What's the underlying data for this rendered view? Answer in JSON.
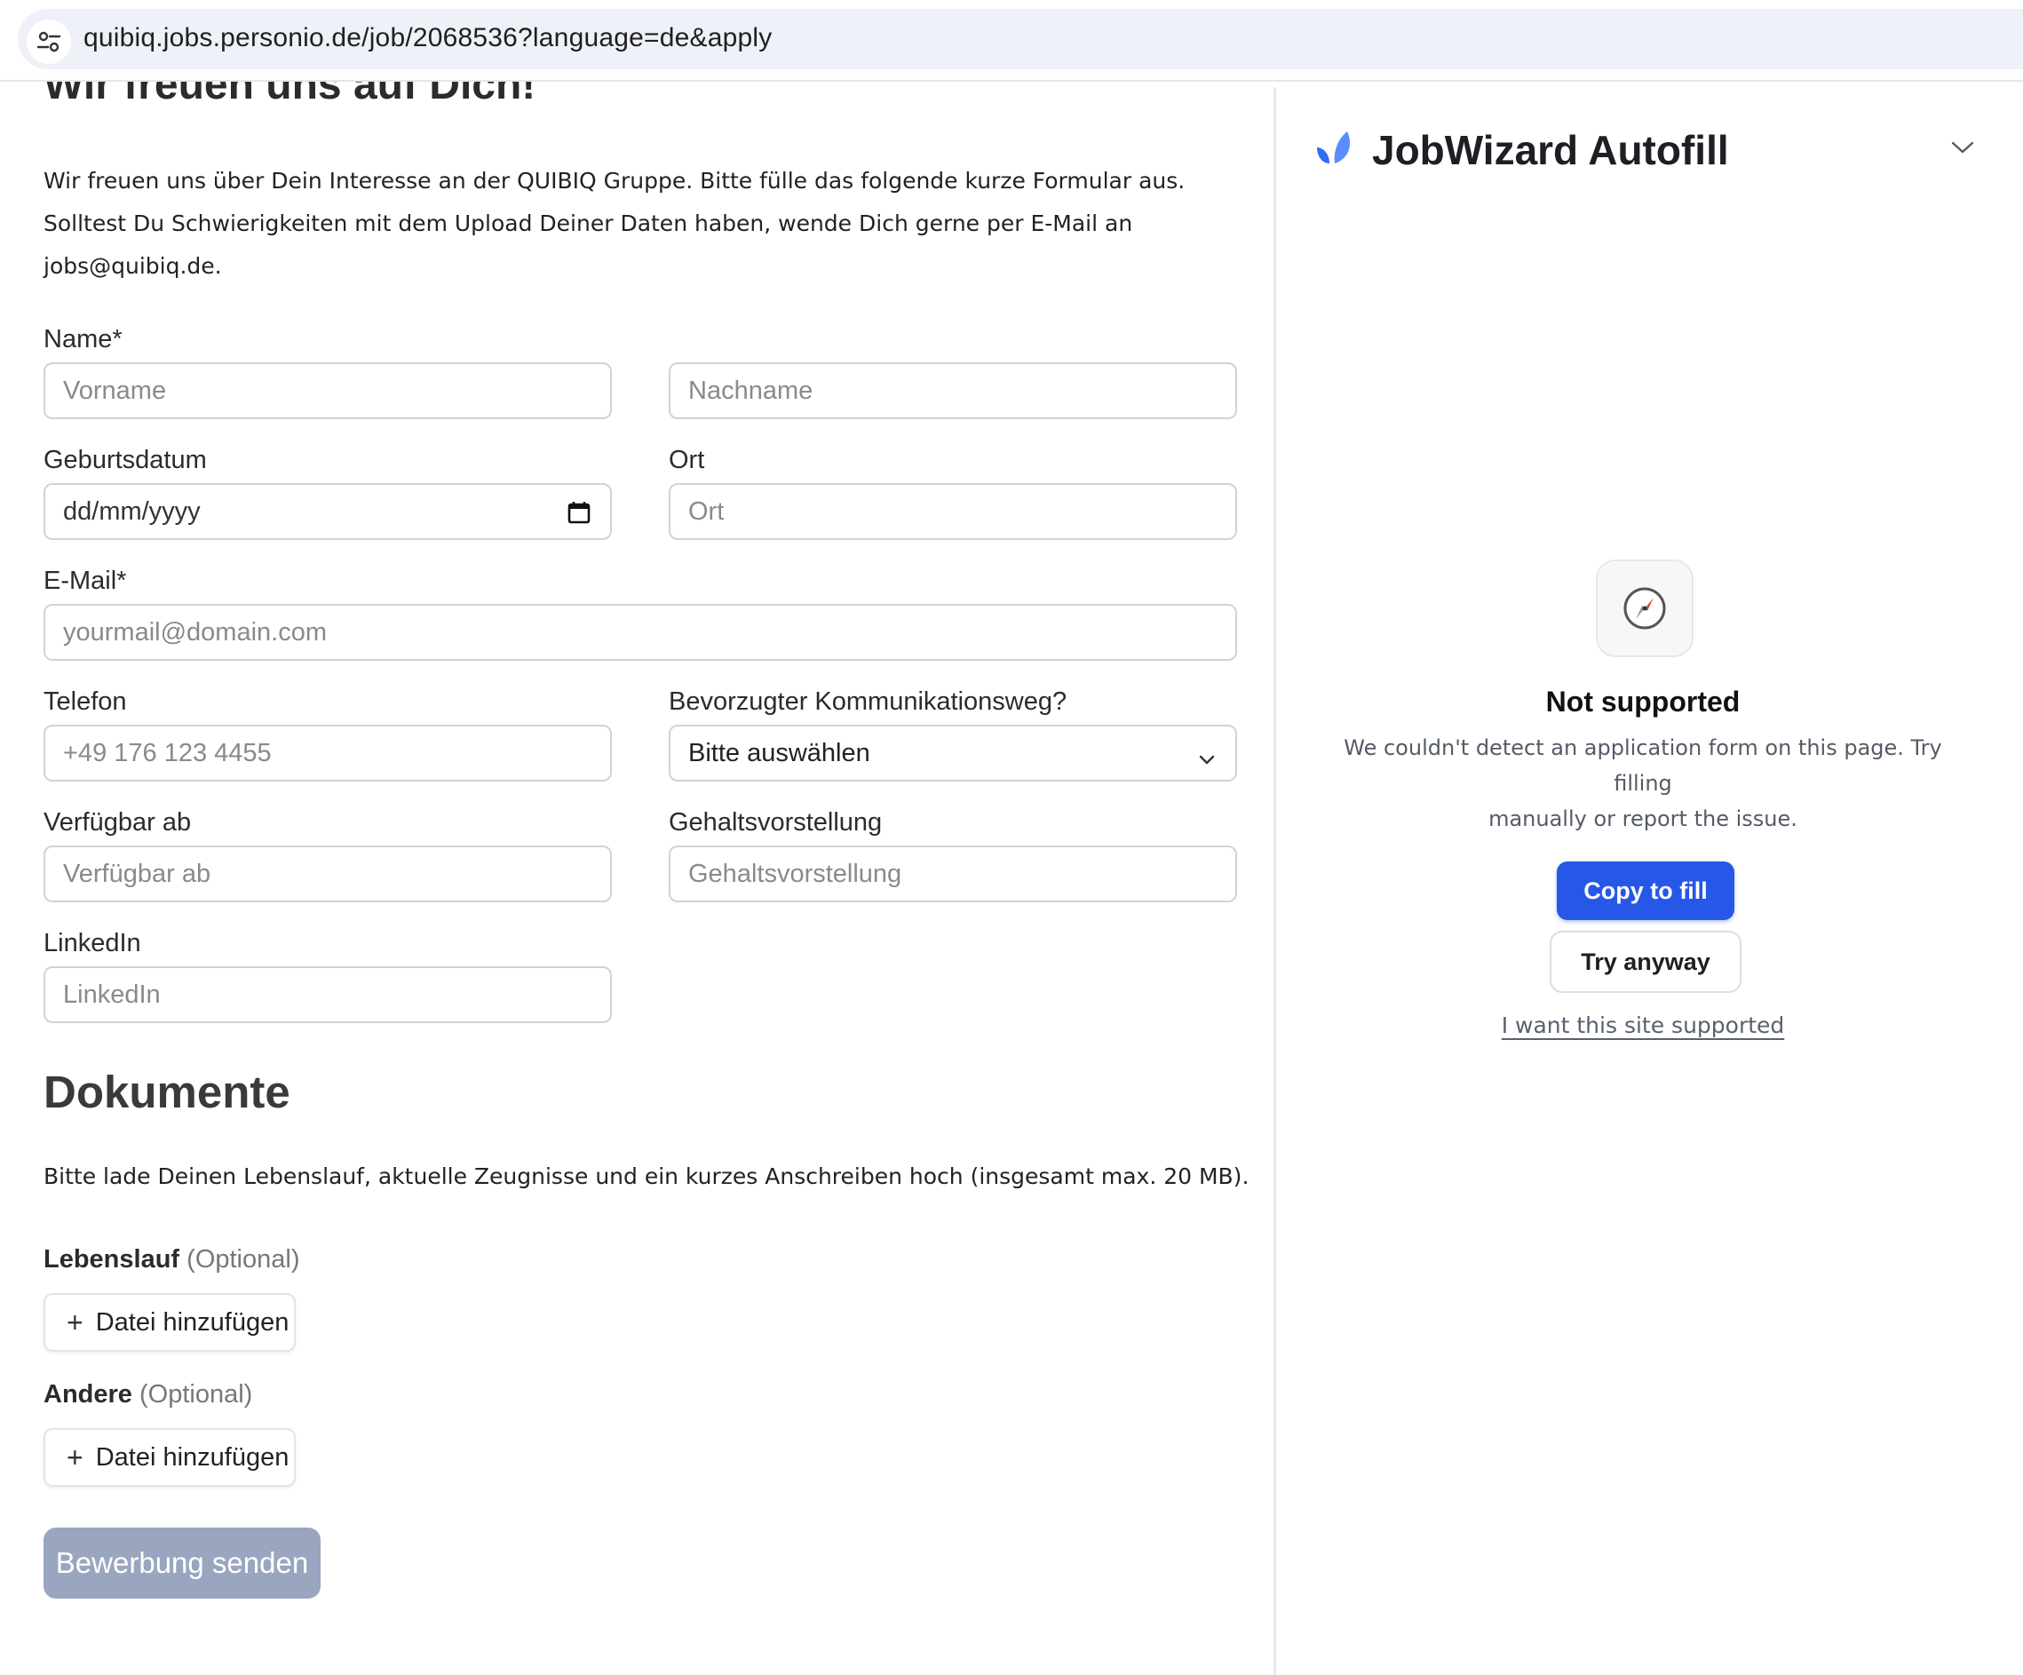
{
  "browser": {
    "url": "quibiq.jobs.personio.de/job/2068536?language=de&apply",
    "site_info_icon": "tune-icon"
  },
  "form": {
    "heading": "Wir freuen uns auf Dich!",
    "intro_line1": "Wir freuen uns über Dein Interesse an der QUIBIQ Gruppe. Bitte fülle das folgende kurze Formular aus.",
    "intro_line2": "Solltest Du Schwierigkeiten mit dem Upload Deiner Daten haben, wende Dich gerne per E-Mail an",
    "intro_line3": "jobs@quibiq.de.",
    "name_label": "Name*",
    "firstname_placeholder": "Vorname",
    "lastname_placeholder": "Nachname",
    "birthdate_label": "Geburtsdatum",
    "birthdate_value": "dd/mm/yyyy",
    "city_label": "Ort",
    "city_placeholder": "Ort",
    "email_label": "E-Mail*",
    "email_placeholder": "yourmail@domain.com",
    "phone_label": "Telefon",
    "phone_placeholder": "+49 176 123 4455",
    "contact_label": "Bevorzugter Kommunikationsweg?",
    "contact_value": "Bitte auswählen",
    "available_label": "Verfügbar ab",
    "available_placeholder": "Verfügbar ab",
    "salary_label": "Gehaltsvorstellung",
    "salary_placeholder": "Gehaltsvorstellung",
    "linkedin_label": "LinkedIn",
    "linkedin_placeholder": "LinkedIn"
  },
  "documents": {
    "heading": "Dokumente",
    "text": "Bitte lade Deinen Lebenslauf, aktuelle Zeugnisse und ein kurzes Anschreiben hoch (insgesamt max. 20 MB).",
    "cv_label": "Lebenslauf",
    "cv_optional": "(Optional)",
    "other_label": "Andere",
    "other_optional": "(Optional)",
    "add_file_label": "Datei hinzufügen",
    "submit_label": "Bewerbung senden"
  },
  "panel": {
    "title": "JobWizard Autofill",
    "status_icon": "compass-icon",
    "status_title": "Not supported",
    "status_desc_line1": "We couldn't detect an application form on this page. Try filling",
    "status_desc_line2": "manually or report the issue.",
    "copy_button": "Copy to fill",
    "try_button": "Try anyway",
    "support_link": "I want this site supported"
  },
  "colors": {
    "primary_button": "#2657e6",
    "submit_disabled": "#9aa6bf",
    "logo_blue": "#2f6df6"
  }
}
